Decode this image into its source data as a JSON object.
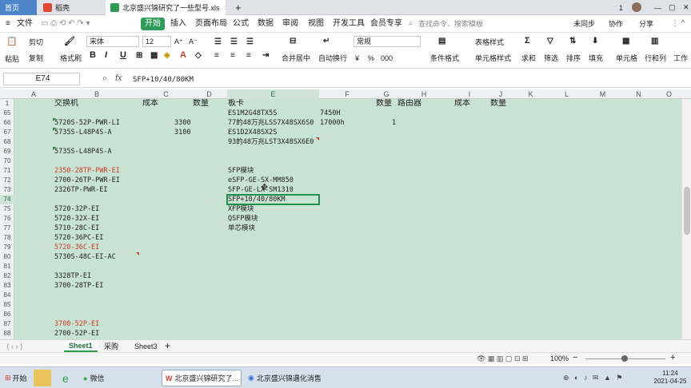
{
  "tabs": {
    "home": "首页",
    "daoke": "稻壳",
    "file": "北京盛兴锦研究了一些型号.xls",
    "new_tab": "+"
  },
  "window": {
    "page_num": "1"
  },
  "menu": {
    "file": "文件",
    "items": [
      "开始",
      "插入",
      "页面布局",
      "公式",
      "数据",
      "审阅",
      "视图",
      "开发工具",
      "会员专享"
    ],
    "search": "查找命令、搜索模板",
    "sync": "未同步",
    "collab": "协作",
    "share": "分享"
  },
  "ribbon": {
    "cut": "剪切",
    "paste": "粘贴",
    "copy": "复制",
    "format_painter": "格式刷",
    "font_name": "宋体",
    "font_size": "12",
    "bold": "B",
    "italic": "I",
    "underline": "U",
    "font_inc": "A⁺",
    "font_dec": "A⁻",
    "merge": "合并居中",
    "wrap": "自动换行",
    "num_format": "常规",
    "yen": "¥",
    "percent": "%",
    "thousands": "000",
    "cond_format": "条件格式",
    "table_style": "表格样式",
    "cell_style": "单元格样式",
    "sum": "求和",
    "filter": "筛选",
    "sort": "排序",
    "fill": "填充",
    "cell": "单元格",
    "rowcol": "行和列",
    "worksheet": "工作"
  },
  "formula": {
    "cell_ref": "E74",
    "fx": "fx",
    "value": "SFP+10/40/80KM"
  },
  "columns": [
    "A",
    "B",
    "C",
    "D",
    "E",
    "F",
    "G",
    "H",
    "I",
    "J",
    "K",
    "L",
    "M",
    "N",
    "O"
  ],
  "rows": [
    {
      "num": "1",
      "b": "交换机",
      "c": "成本",
      "d": "数量",
      "e": "板卡",
      "g": "数量",
      "h": "路由器",
      "i": "成本",
      "j": "数量"
    },
    {
      "num": "65",
      "e": "ES1M2G48TX5S",
      "f": "7450H"
    },
    {
      "num": "66",
      "b": "5720S-52P-PWR-LI",
      "c": "3300",
      "e": "77的48万兆LSS7X48SX6S0",
      "f": "17000h",
      "g": "1"
    },
    {
      "num": "67",
      "b": "5735S-L48P4S-A",
      "c": "3100",
      "e": "ES1D2X48SX2S"
    },
    {
      "num": "68",
      "e": "93的48万兆LST3X48SX6E0"
    },
    {
      "num": "69",
      "b": "5735S-L48P4S-A"
    },
    {
      "num": "70"
    },
    {
      "num": "71",
      "b": "2350-28TP-PWR-EI",
      "e": "SFP模块"
    },
    {
      "num": "72",
      "b": "2700-26TP-PWR-EI",
      "e": "eSFP-GE-SX-MM850"
    },
    {
      "num": "73",
      "b": "2326TP-PWR-EI",
      "e": "SFP-GE-LX-SM1310"
    },
    {
      "num": "74",
      "e": "SFP+10/40/80KM"
    },
    {
      "num": "75",
      "b": "5720-32P-EI",
      "e": "XFP模块"
    },
    {
      "num": "76",
      "b": "5720-32X-EI",
      "e": "QSFP模块"
    },
    {
      "num": "77",
      "b": "5710-28C-EI",
      "e": "单芯模块"
    },
    {
      "num": "78",
      "b": "5720-36PC-EI"
    },
    {
      "num": "79",
      "b": "5720-36C-EI"
    },
    {
      "num": "80",
      "b": "5730S-48C-EI-AC"
    },
    {
      "num": "81"
    },
    {
      "num": "82",
      "b": "3328TP-EI"
    },
    {
      "num": "83",
      "b": "3700-28TP-EI"
    },
    {
      "num": "84"
    },
    {
      "num": "85"
    },
    {
      "num": "86"
    },
    {
      "num": "87",
      "b": "3700-52P-EI"
    },
    {
      "num": "88",
      "b": "2700-52P-EI"
    }
  ],
  "sheets": {
    "active": "Sheet1",
    "s2": "采购",
    "s3": "Sheet3",
    "add": "+"
  },
  "status": {
    "zoom": "100%",
    "zoom_minus": "−",
    "zoom_plus": "+"
  },
  "taskbar": {
    "start": "开始",
    "wechat": "微信",
    "wps_task": "北京盛兴锦研究了...",
    "chrome_task": "北京盛兴锦遇化消售",
    "time": "11:24",
    "date": "2021-04-25"
  },
  "colors": {
    "grid_bg": "#c8e3d2",
    "selection": "#1d8f50",
    "accent_wps": "#d33a2a",
    "red_text": "#d03a2a"
  }
}
